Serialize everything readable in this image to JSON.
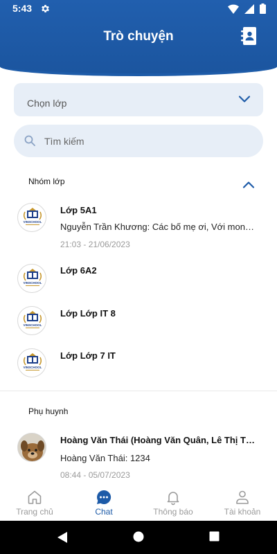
{
  "status_bar": {
    "time": "5:43"
  },
  "header": {
    "title": "Trò chuyện"
  },
  "class_select": {
    "label": "Chọn lớp"
  },
  "search": {
    "placeholder": "Tìm kiếm"
  },
  "groups_section": {
    "title": "Nhóm lớp",
    "items": [
      {
        "title": "Lớp 5A1",
        "message": "Nguyễn Trần Khương: Các bố mẹ ơi,  Với mong muốn",
        "time": "21:03 - 21/06/2023",
        "avatar": "school-logo"
      },
      {
        "title": "Lớp 6A2",
        "avatar": "school-logo"
      },
      {
        "title": "Lớp Lớp IT 8",
        "avatar": "school-logo"
      },
      {
        "title": "Lớp Lớp 7 IT",
        "avatar": "school-logo"
      }
    ]
  },
  "parents_section": {
    "title": "Phụ huynh",
    "items": [
      {
        "title": "Hoàng Văn Thái (Hoàng Văn Quân, Lê Thị Thu)",
        "message": "Hoàng Văn Thái: 1234",
        "time": "08:44 - 05/07/2023",
        "avatar": "dog-photo"
      }
    ]
  },
  "logo_text": "VINSCHOOL",
  "bottom_nav": [
    {
      "label": "Trang chủ",
      "icon": "home-icon",
      "active": false
    },
    {
      "label": "Chat",
      "icon": "chat-icon",
      "active": true
    },
    {
      "label": "Thông báo",
      "icon": "bell-icon",
      "active": false
    },
    {
      "label": "Tài khoản",
      "icon": "user-icon",
      "active": false
    }
  ],
  "colors": {
    "primary": "#1d5ba8",
    "field_bg": "#e7eef7",
    "muted": "#9a9a9a"
  }
}
